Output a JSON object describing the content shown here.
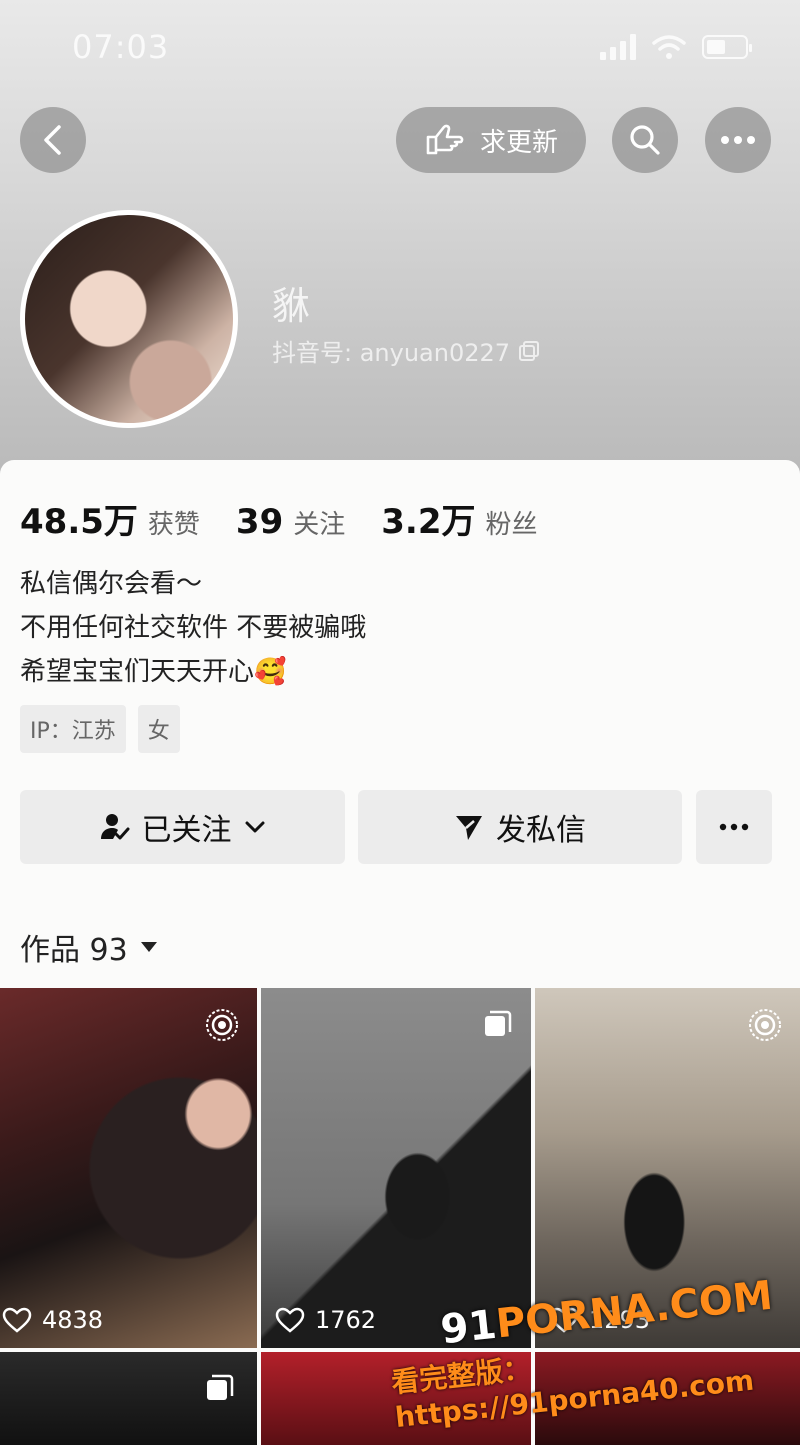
{
  "status_bar": {
    "time": "07:03"
  },
  "header": {
    "back_icon": "chevron-left-icon",
    "update_request_label": "求更新",
    "search_icon": "search-icon",
    "more_icon": "more-dots-icon"
  },
  "profile": {
    "name": "貅",
    "douyin_id": "抖音号: anyuan0227"
  },
  "stats": [
    {
      "value": "48.5万",
      "label": "获赞"
    },
    {
      "value": "39",
      "label": "关注"
    },
    {
      "value": "3.2万",
      "label": "粉丝"
    }
  ],
  "bio": {
    "line1": "私信偶尔会看～",
    "line2": "不用任何社交软件 不要被骗哦",
    "line3": "希望宝宝们天天开心",
    "emoji": "🥰"
  },
  "tags": [
    "IP：江苏",
    "女"
  ],
  "actions": {
    "followed_label": "已关注",
    "message_label": "发私信"
  },
  "works": {
    "label": "作品 93"
  },
  "grid": [
    {
      "likes": "4838",
      "icon": "live-icon"
    },
    {
      "likes": "1762",
      "icon": "gallery-icon"
    },
    {
      "likes": "1293",
      "icon": "live-icon"
    }
  ],
  "watermark": {
    "line1_a": "91",
    "line1_b": "PORNA.COM",
    "line2": "看完整版：https://91porna40.com"
  }
}
